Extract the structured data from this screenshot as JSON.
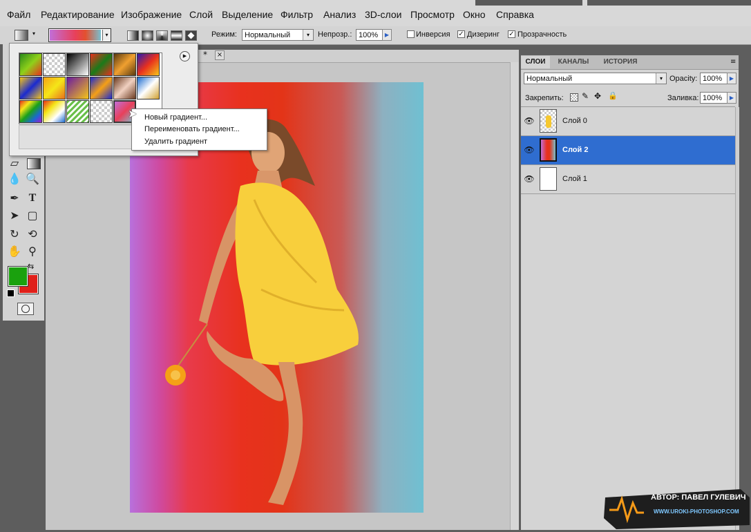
{
  "menu": [
    "Файл",
    "Редактирование",
    "Изображение",
    "Слой",
    "Выделение",
    "Фильтр",
    "Анализ",
    "3D-слои",
    "Просмотр",
    "Окно",
    "Справка"
  ],
  "options": {
    "mode_label": "Режим:",
    "mode_value": "Нормальный",
    "opacity_label": "Непрозр.:",
    "opacity_value": "100%",
    "reverse_label": "Инверсия",
    "dither_label": "Дизеринг",
    "transparency_label": "Прозрачность",
    "reverse_checked": false,
    "dither_checked": true,
    "transparency_checked": true
  },
  "document": {
    "tab_suffix": "*",
    "close_glyph": "×"
  },
  "context_menu": [
    "Новый градиент...",
    "Переименовать градиент...",
    "Удалить градиент"
  ],
  "layers_panel": {
    "tabs": [
      "СЛОИ",
      "КАНАЛЫ",
      "ИСТОРИЯ"
    ],
    "blend_mode": "Нормальный",
    "opacity_label": "Opacity:",
    "opacity_value": "100%",
    "lock_label": "Закрепить:",
    "fill_label": "Заливка:",
    "fill_value": "100%",
    "layers": [
      {
        "name": "Слой 0",
        "selected": false
      },
      {
        "name": "Слой 2",
        "selected": true
      },
      {
        "name": "Слой 1",
        "selected": false
      }
    ]
  },
  "colors": {
    "foreground": "#1aa10e",
    "background": "#e0201a",
    "selection": "#2f6dd0"
  },
  "watermark": {
    "author": "АВТОР: ПАВЕЛ ГУЛЕВИЧ",
    "site": "WWW.UROKI-PHOTOSHOP.COM"
  }
}
